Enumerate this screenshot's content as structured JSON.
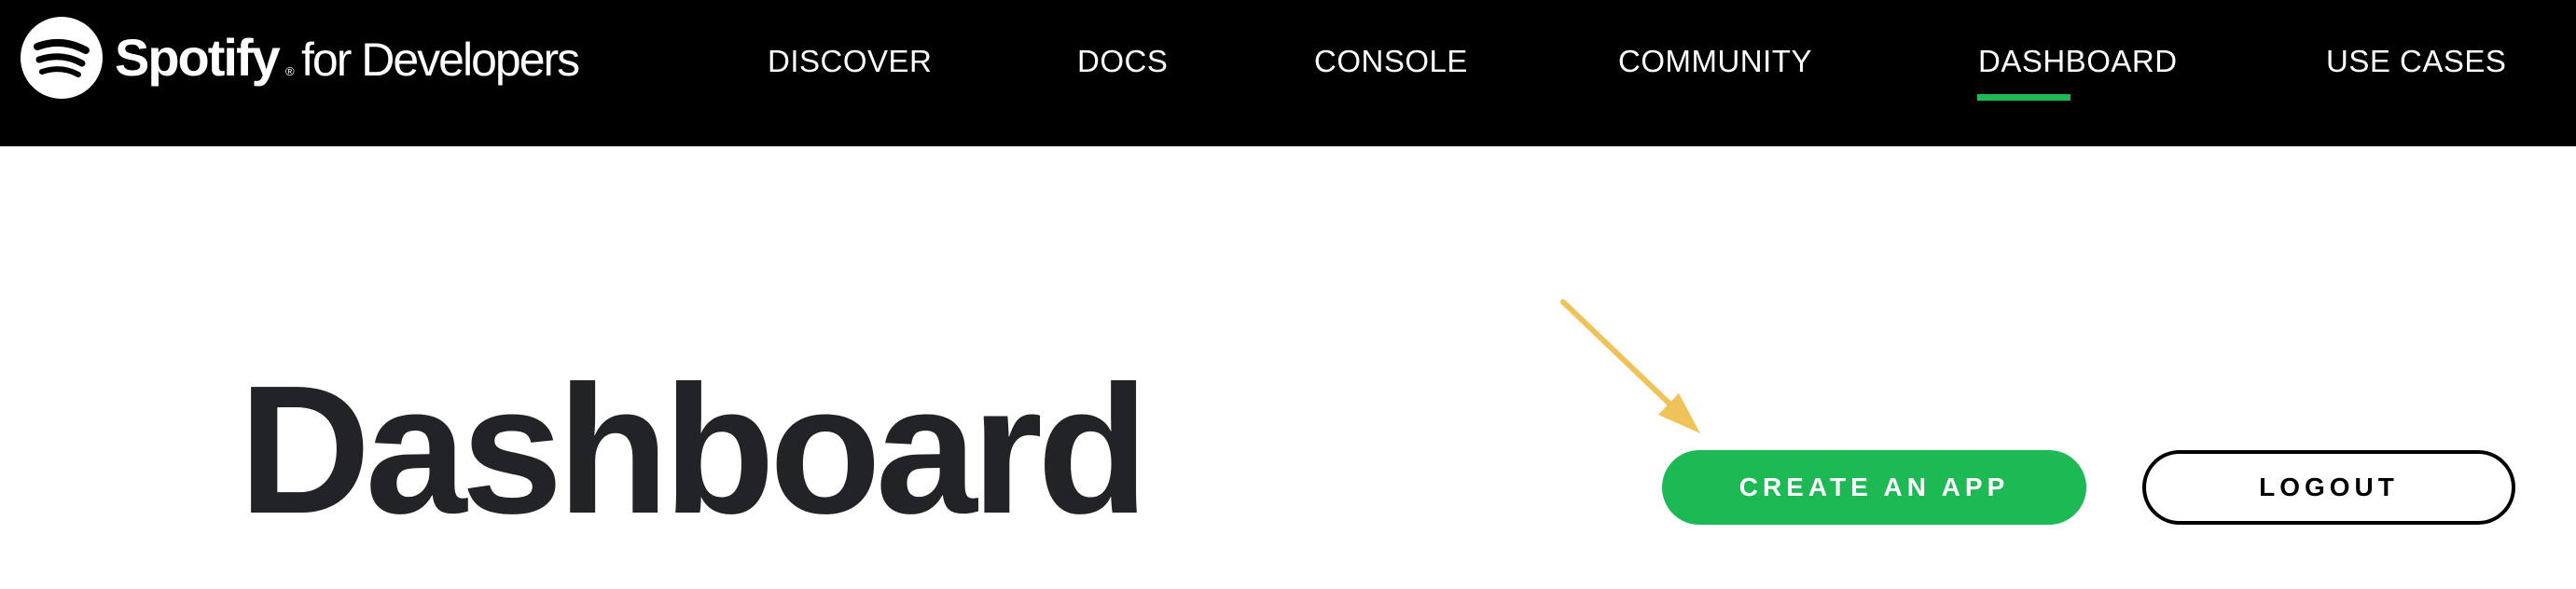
{
  "navbar": {
    "brand": "Spotify",
    "brand_mark": "®",
    "brand_suffix": "for Developers",
    "logo_icon": "spotify-logo-icon",
    "items": [
      {
        "label": "DISCOVER",
        "active": false
      },
      {
        "label": "DOCS",
        "active": false
      },
      {
        "label": "CONSOLE",
        "active": false
      },
      {
        "label": "COMMUNITY",
        "active": false
      },
      {
        "label": "DASHBOARD",
        "active": true
      },
      {
        "label": "USE CASES",
        "active": false
      }
    ],
    "active_indicator_color": "#1db954"
  },
  "main": {
    "title": "Dashboard",
    "create_button_label": "CREATE AN APP",
    "logout_button_label": "LOGOUT",
    "annotation": {
      "icon": "arrow-pointer-icon",
      "color": "#efc35a",
      "points_to": "create-app-button"
    }
  },
  "colors": {
    "brand_green": "#1db954",
    "navbar_bg": "#000000",
    "title_text": "#222326"
  }
}
